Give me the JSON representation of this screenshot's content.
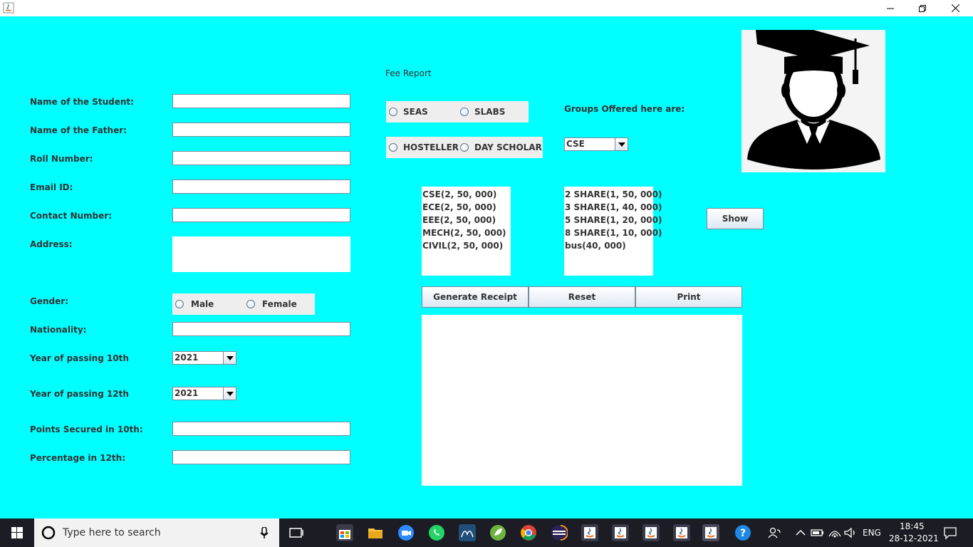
{
  "form": {
    "fee_report_title": "Fee Report",
    "labels": {
      "student_name": "Name of the Student:",
      "father_name": "Name of the Father:",
      "roll_number": "Roll Number:",
      "email": "Email ID:",
      "contact": "Contact Number:",
      "address": "Address:",
      "gender": "Gender:",
      "nationality": "Nationality:",
      "year10": "Year of passing 10th",
      "year12": "Year of passing 12th",
      "points10": "Points Secured in 10th:",
      "percentage12": "Percentage in 12th:"
    },
    "values": {
      "student_name": "",
      "father_name": "",
      "roll_number": "",
      "email": "",
      "contact": "",
      "address": "",
      "nationality": "",
      "points10": "",
      "percentage12": ""
    },
    "gender_options": [
      "Male",
      "Female"
    ],
    "year10_selected": "2021",
    "year12_selected": "2021"
  },
  "fee": {
    "school_options": [
      "SEAS",
      "SLABS"
    ],
    "residence_options": [
      "HOSTELLER",
      "DAY SCHOLAR"
    ],
    "groups_label": "Groups Offered here are:",
    "group_selected": "CSE",
    "groups_list": [
      "CSE(2, 50, 000)",
      "ECE(2, 50, 000)",
      "EEE(2, 50, 000)",
      "MECH(2, 50, 000)",
      "CIVIL(2, 50, 000)"
    ],
    "hostel_list": [
      "2 SHARE(1, 50, 000)",
      "3 SHARE(1, 40, 000)",
      "5 SHARE(1, 20, 000)",
      "8 SHARE(1, 10, 000)",
      "bus(40, 000)"
    ],
    "show_button": "Show",
    "generate_button": "Generate Receipt",
    "reset_button": "Reset",
    "print_button": "Print",
    "receipt_text": ""
  },
  "taskbar": {
    "search_placeholder": "Type here to search",
    "language": "ENG",
    "time": "18:45",
    "date": "28-12-2021"
  },
  "colors": {
    "background": "#00ffff",
    "taskbar": "#1c1c24"
  }
}
